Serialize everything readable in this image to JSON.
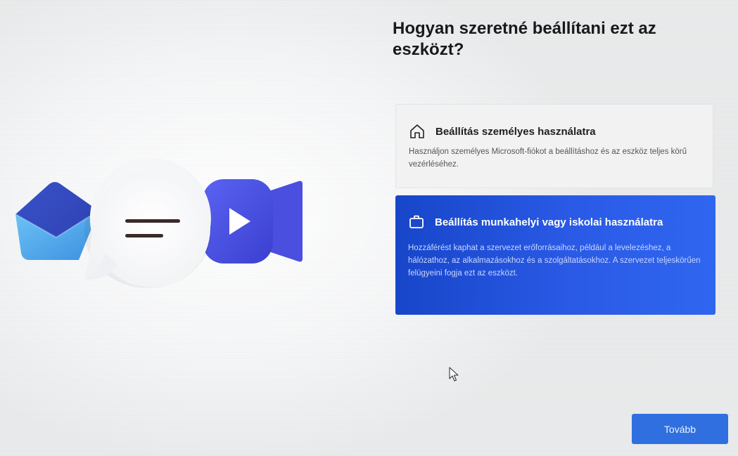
{
  "page": {
    "title": "Hogyan szeretné beállítani ezt az eszközt?"
  },
  "options": [
    {
      "title": "Beállítás személyes használatra",
      "description": "Használjon személyes Microsoft-fiókot a beállításhoz és az eszköz teljes körű vezérléséhez.",
      "icon": "home-icon",
      "selected": false
    },
    {
      "title": "Beállítás munkahelyi vagy iskolai használatra",
      "description": "Hozzáférést kaphat a szervezet erőforrásaihoz, például a levelezéshez, a hálózathoz, az alkalmazásokhoz és a szolgáltatásokhoz. A szervezet teljeskörűen felügyeini fogja ezt az eszközt.",
      "icon": "briefcase-icon",
      "selected": true
    }
  ],
  "footer": {
    "next_label": "Tovább"
  },
  "illustration": {
    "icons": [
      "mail-icon",
      "chat-bubble-icon",
      "video-camera-icon"
    ]
  },
  "colors": {
    "accent": "#2f66f0",
    "selected_card": "#1f4fd8",
    "button": "#2f6fe0"
  }
}
